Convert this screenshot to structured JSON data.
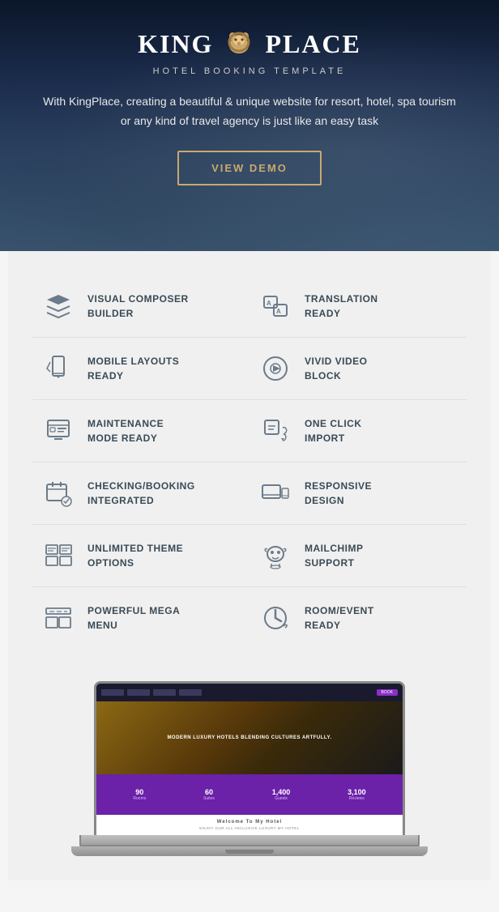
{
  "hero": {
    "logo": {
      "king": "KING",
      "place": "PLACE",
      "subtitle": "HOTEL BOOKING TEMPLATE"
    },
    "description": "With KingPlace, creating a beautiful & unique website for resort, hotel, spa tourism or any kind of travel agency is just like an easy task",
    "cta_label": "VIEW DEMO"
  },
  "features": [
    {
      "id": "visual-composer",
      "label": "VISUAL COMPOSER\nBUILDER",
      "icon": "layers"
    },
    {
      "id": "translation-ready",
      "label": "TRANSLATION\nREADY",
      "icon": "translate"
    },
    {
      "id": "mobile-layouts",
      "label": "MOBILE LAYOUTS\nREADY",
      "icon": "mobile"
    },
    {
      "id": "vivid-video",
      "label": "VIVID VIDEO\nBLOCK",
      "icon": "video"
    },
    {
      "id": "maintenance-mode",
      "label": "MAINTENANCE\nMODE READY",
      "icon": "maintenance"
    },
    {
      "id": "one-click-import",
      "label": "ONE CLICK\nIMPORT",
      "icon": "import"
    },
    {
      "id": "checking-booking",
      "label": "CHECKING/BOOKING\nINTEGRATED",
      "icon": "calendar"
    },
    {
      "id": "responsive-design",
      "label": "RESPONSIVE\nDESIGN",
      "icon": "responsive"
    },
    {
      "id": "unlimited-theme",
      "label": "UNLIMITED THEME\nOPTIONS",
      "icon": "theme"
    },
    {
      "id": "mailchimp",
      "label": "MAILCHIMP\nSUPPORT",
      "icon": "email"
    },
    {
      "id": "mega-menu",
      "label": "POWERFUL MEGA\nMENU",
      "icon": "menu"
    },
    {
      "id": "room-event",
      "label": "ROOM/EVENT\nREADY",
      "icon": "room"
    }
  ],
  "preview": {
    "screen_hero_text": "MODERN LUXURY HOTELS BLENDING CULTURES ARTFULLY.",
    "welcome_title": "Welcome To My Hotel",
    "welcome_sub": "ENJOY OUR ALL-INCLUSIVE LUXURY MY HOTEL",
    "stats": [
      {
        "num": "90",
        "label": "Rooms"
      },
      {
        "num": "60",
        "label": "Suites"
      },
      {
        "num": "1,400",
        "label": "Guests"
      },
      {
        "num": "3,100",
        "label": "Reviews"
      }
    ]
  }
}
